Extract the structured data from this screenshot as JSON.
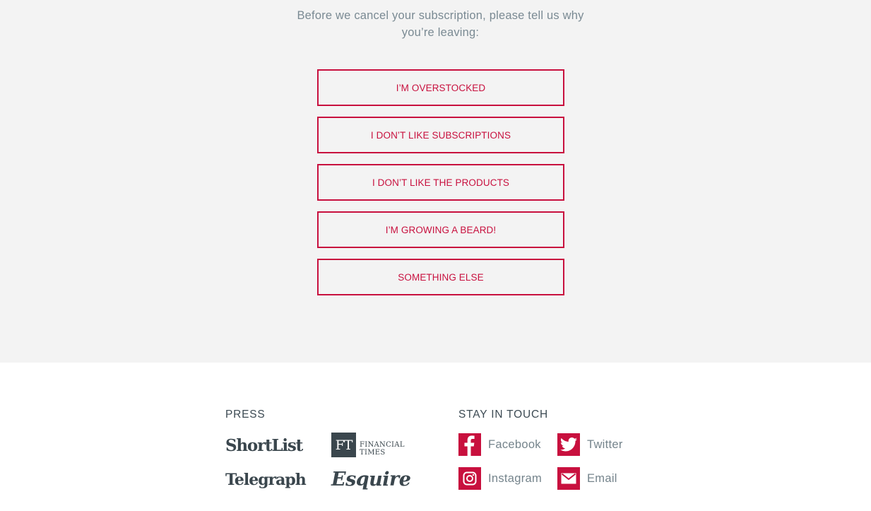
{
  "prompt": {
    "line1": "Before we cancel your subscription, please tell us why",
    "line2": "you’re leaving:"
  },
  "reasons": [
    "I’M OVERSTOCKED",
    "I DON’T LIKE SUBSCRIPTIONS",
    "I DON’T LIKE THE PRODUCTS",
    "I’M GROWING A BEARD!",
    "SOMETHING ELSE"
  ],
  "footer": {
    "press_title": "PRESS",
    "stay_title": "STAY IN TOUCH",
    "press": {
      "shortlist": "ShortList",
      "ft_box": "FT",
      "ft_line1": "FINANCIAL",
      "ft_line2": "TIMES",
      "telegraph": "Telegraph",
      "esquire": "Esquire"
    },
    "social": {
      "facebook": "Facebook",
      "twitter": "Twitter",
      "instagram": "Instagram",
      "email": "Email"
    }
  },
  "colors": {
    "accent": "#c8103e",
    "text_muted": "#7a8a93",
    "text_dark": "#3c4a53",
    "background_top": "#f3f3f3"
  },
  "icons": [
    "facebook-icon",
    "twitter-icon",
    "instagram-icon",
    "email-icon"
  ]
}
